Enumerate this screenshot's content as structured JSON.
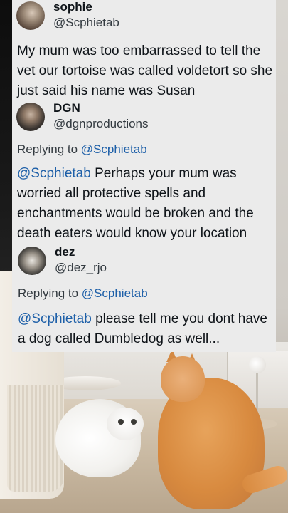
{
  "tweets": [
    {
      "name": "sophie",
      "handle": "@Scphietab",
      "text": "My mum was too embarrassed to tell the vet our tortoise was called voldetort so she just said his name was Susan"
    },
    {
      "name": "DGN",
      "handle": "@dgnproductions",
      "replying_prefix": "Replying to ",
      "replying_to": "@Scphietab",
      "mention": "@Scphietab",
      "text": " Perhaps your mum was worried all protective spells and enchantments would be broken and the death eaters would know your location"
    },
    {
      "name": "dez",
      "handle": "@dez_rjo",
      "replying_prefix": "Replying to ",
      "replying_to": "@Scphietab",
      "mention": "@Scphietab",
      "text": " please tell me you dont have a dog called Dumbledog as well..."
    }
  ],
  "colors": {
    "card_background": "#ebebeb",
    "mention": "#1d5fa8",
    "text": "#0f1419",
    "secondary_text": "#333a40"
  },
  "icons": {
    "avatars": [
      "sophie-avatar",
      "dgn-avatar",
      "dez-avatar"
    ]
  }
}
